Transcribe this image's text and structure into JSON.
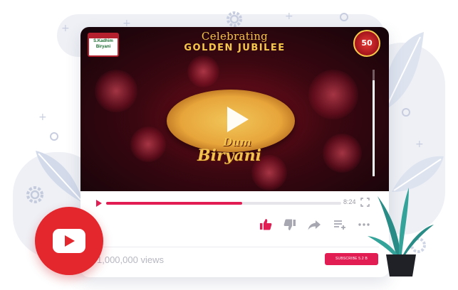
{
  "video": {
    "headline_line1": "Celebrating",
    "headline_line2": "GOLDEN JUBILEE",
    "dish_line1": "Dum",
    "dish_line2": "Biryani",
    "brand_logo_text": "S.Kadhim Biryani",
    "anniversary_badge_text": "50",
    "volume_level": 0.9
  },
  "player": {
    "progress_fraction": 0.58,
    "time": "8:24",
    "views": "1,000,000 views",
    "subscribe_label": "SUBSCRIBE 5.2 B"
  },
  "colors": {
    "accent": "#e21d53",
    "youtube_red": "#e4262d",
    "plant": "#2a8c86",
    "pot": "#1f2126"
  },
  "icons": [
    "play-icon",
    "fullscreen-icon",
    "like-icon",
    "dislike-icon",
    "share-icon",
    "add-to-playlist-icon",
    "more-icon",
    "youtube-logo-icon",
    "gear-icon",
    "leaf-icon",
    "plant-icon"
  ]
}
